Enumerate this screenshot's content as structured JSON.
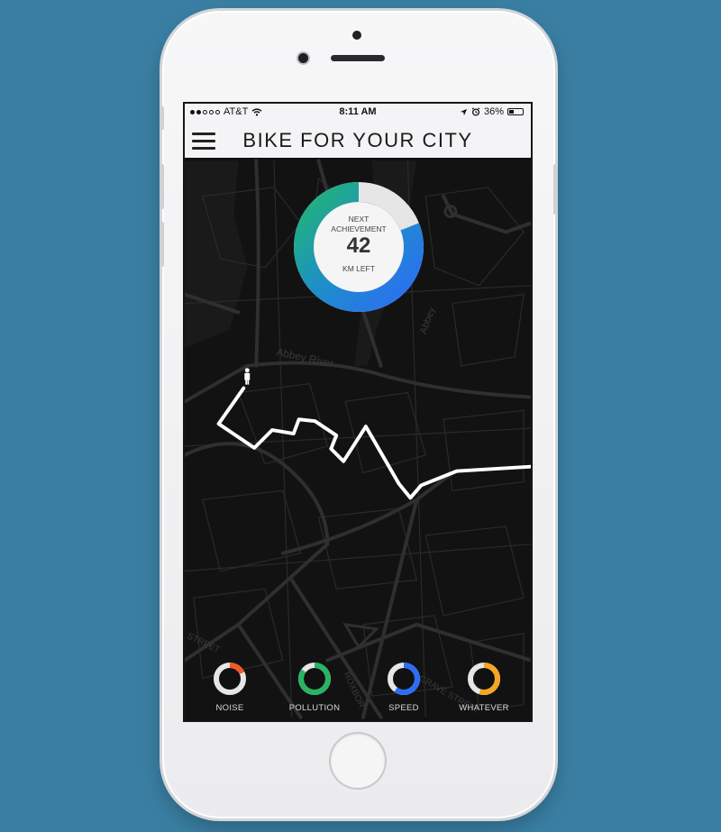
{
  "status_bar": {
    "carrier": "AT&T",
    "signal_dots_filled": 2,
    "signal_dots_total": 5,
    "time": "8:11 AM",
    "battery": "36%",
    "battery_level": 0.36,
    "icons": [
      "wifi-icon",
      "location-arrow-icon",
      "alarm-clock-icon",
      "battery-icon"
    ]
  },
  "header": {
    "title": "BIKE FOR YOUR CITY"
  },
  "achievement": {
    "line1": "NEXT",
    "line2": "ACHIEVEMENT",
    "value": "42",
    "unit": "KM LEFT",
    "progress_fraction": 0.81
  },
  "map": {
    "labels": [
      "Abbey River",
      "Abbey",
      "STREET",
      "ROXBOR",
      "GRAVE STREET"
    ]
  },
  "metrics": [
    {
      "label": "NOISE",
      "level": 0.18,
      "color": "#f05a22"
    },
    {
      "label": "POLLUTION",
      "level": 0.85,
      "color": "#28b463"
    },
    {
      "label": "SPEED",
      "level": 0.6,
      "color": "#2d6df5"
    },
    {
      "label": "WHATEVER",
      "level": 0.55,
      "color": "#f5a623"
    }
  ],
  "colors": {
    "background": "#3a7fa3",
    "map_background": "#111112",
    "gauge_blue": "#2d6df5",
    "gauge_green": "#22b573",
    "gauge_track": "#e6e6e6"
  }
}
